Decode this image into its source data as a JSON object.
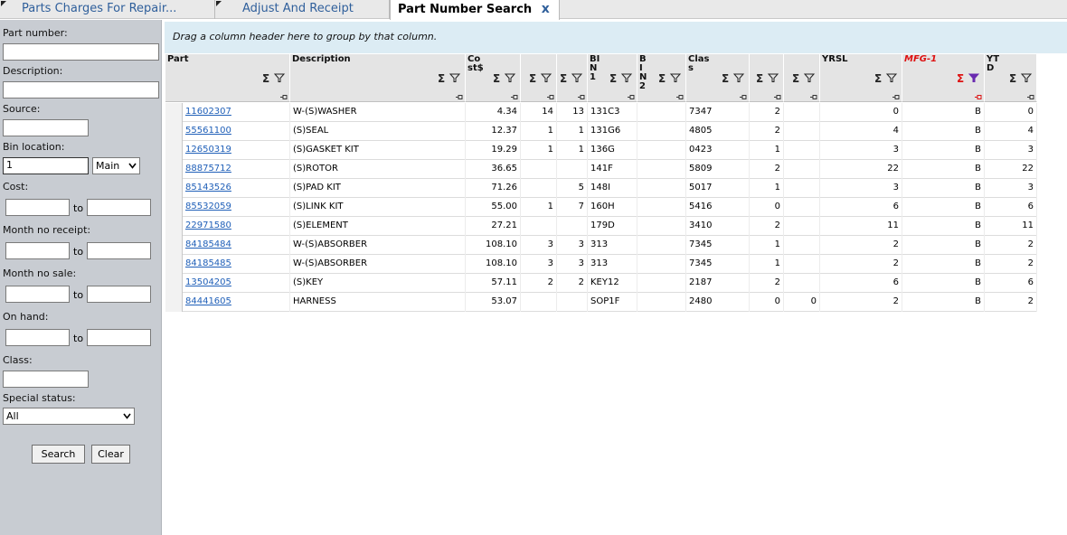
{
  "tabs": [
    {
      "label": "Parts Charges For Repair..."
    },
    {
      "label": "Adjust And Receipt"
    },
    {
      "label": "Part Number Search",
      "close": "x"
    }
  ],
  "filters": {
    "part_number_label": "Part number:",
    "description_label": "Description:",
    "source_label": "Source:",
    "bin_location_label": "Bin location:",
    "bin_location_value": "1",
    "bin_location_select": "Main",
    "cost_label": "Cost:",
    "month_no_receipt_label": "Month no receipt:",
    "month_no_sale_label": "Month no sale:",
    "on_hand_label": "On hand:",
    "class_label": "Class:",
    "special_status_label": "Special status:",
    "special_status_value": "All",
    "to": "to",
    "search_button": "Search",
    "clear_button": "Clear"
  },
  "grid": {
    "group_hint": "Drag a column header here to group by that column.",
    "headers": [
      "Part",
      "Description",
      "Co\nst$",
      "",
      "",
      "BI\nN\n1",
      "B\nI\nN\n2",
      "Clas\ns",
      "",
      "",
      "YRSL",
      "MFG-1",
      "YT\nD"
    ],
    "rows": [
      [
        "11602307",
        "W-(S)WASHER",
        "4.34",
        "14",
        "13",
        "131C3",
        "",
        "7347",
        "2",
        "",
        "0",
        "B",
        "0"
      ],
      [
        "55561100",
        "(S)SEAL",
        "12.37",
        "1",
        "1",
        "131G6",
        "",
        "4805",
        "2",
        "",
        "4",
        "B",
        "4"
      ],
      [
        "12650319",
        "(S)GASKET KIT",
        "19.29",
        "1",
        "1",
        "136G",
        "",
        "0423",
        "1",
        "",
        "3",
        "B",
        "3"
      ],
      [
        "88875712",
        "(S)ROTOR",
        "36.65",
        "",
        "",
        "141F",
        "",
        "5809",
        "2",
        "",
        "22",
        "B",
        "22"
      ],
      [
        "85143526",
        "(S)PAD KIT",
        "71.26",
        "",
        "5",
        "148I",
        "",
        "5017",
        "1",
        "",
        "3",
        "B",
        "3"
      ],
      [
        "85532059",
        "(S)LINK KIT",
        "55.00",
        "1",
        "7",
        "160H",
        "",
        "5416",
        "0",
        "",
        "6",
        "B",
        "6"
      ],
      [
        "22971580",
        "(S)ELEMENT",
        "27.21",
        "",
        "",
        "179D",
        "",
        "3410",
        "2",
        "",
        "11",
        "B",
        "11"
      ],
      [
        "84185484",
        "W-(S)ABSORBER",
        "108.10",
        "3",
        "3",
        "313",
        "",
        "7345",
        "1",
        "",
        "2",
        "B",
        "2"
      ],
      [
        "84185485",
        "W-(S)ABSORBER",
        "108.10",
        "3",
        "3",
        "313",
        "",
        "7345",
        "1",
        "",
        "2",
        "B",
        "2"
      ],
      [
        "13504205",
        "(S)KEY",
        "57.11",
        "2",
        "2",
        "KEY12",
        "",
        "2187",
        "2",
        "",
        "6",
        "B",
        "6"
      ],
      [
        "84441605",
        "HARNESS",
        "53.07",
        "",
        "",
        "SOP1F",
        "",
        "2480",
        "0",
        "0",
        "2",
        "B",
        "2"
      ]
    ]
  },
  "colors": {
    "link": "#1f5fb8",
    "accent_red": "#d11111",
    "group_bar": "#dcecf4",
    "sidebar": "#c8ccd2"
  }
}
